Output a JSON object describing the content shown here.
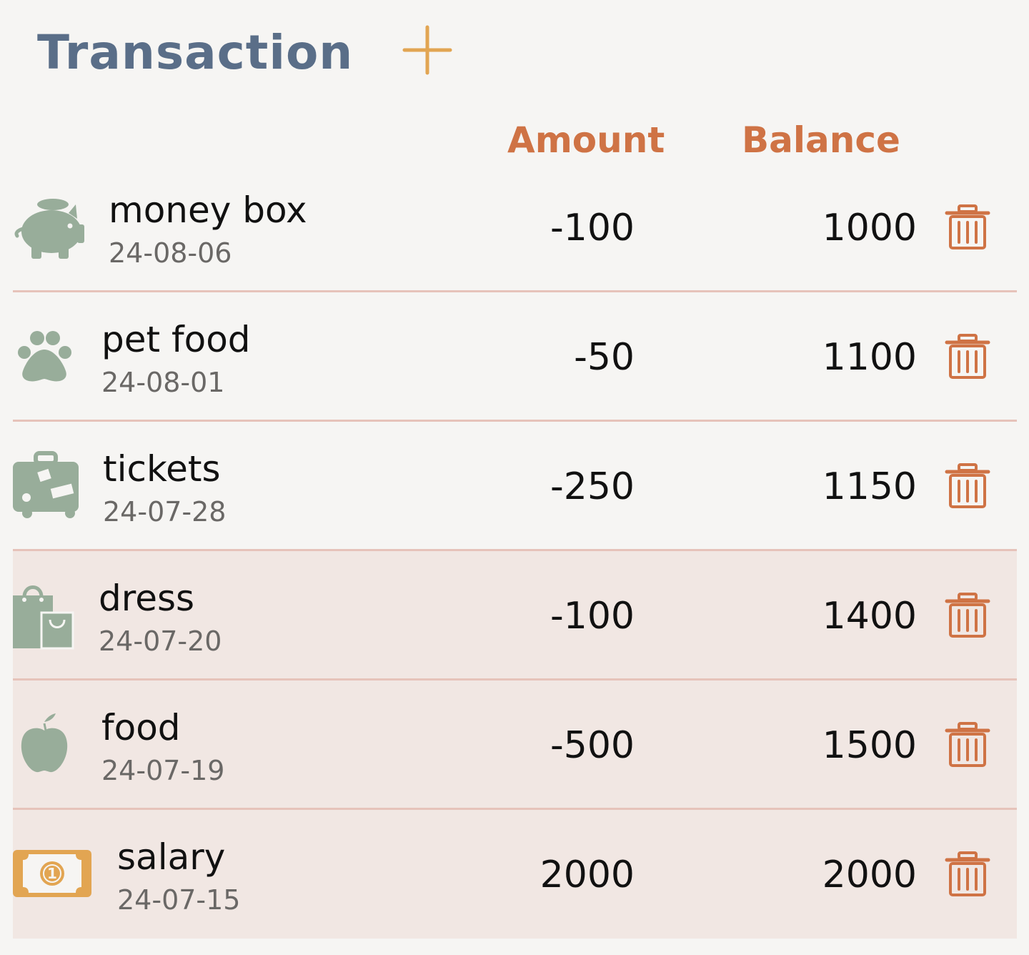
{
  "header": {
    "title": "Transaction",
    "add_icon": "plus-icon"
  },
  "columns": {
    "amount": "Amount",
    "balance": "Balance"
  },
  "colors": {
    "title": "#5a6e88",
    "accent": "#cf7345",
    "add": "#e2a552",
    "category_icon": "#98ad9a",
    "income_icon": "#e2a552",
    "row_tint": "#f1e7e3",
    "divider": "#e6c3ba"
  },
  "transactions": [
    {
      "name": "money box",
      "date": "24-08-06",
      "amount": "-100",
      "balance": "1000",
      "icon": "piggy-bank-icon"
    },
    {
      "name": "pet food",
      "date": "24-08-01",
      "amount": "-50",
      "balance": "1100",
      "icon": "paw-icon"
    },
    {
      "name": "tickets",
      "date": "24-07-28",
      "amount": "-250",
      "balance": "1150",
      "icon": "suitcase-icon"
    },
    {
      "name": "dress",
      "date": "24-07-20",
      "amount": "-100",
      "balance": "1400",
      "icon": "shopping-bags-icon"
    },
    {
      "name": "food",
      "date": "24-07-19",
      "amount": "-500",
      "balance": "1500",
      "icon": "apple-icon"
    },
    {
      "name": "salary",
      "date": "24-07-15",
      "amount": "2000",
      "balance": "2000",
      "icon": "banknote-icon"
    }
  ],
  "delete_icon": "trash-icon"
}
